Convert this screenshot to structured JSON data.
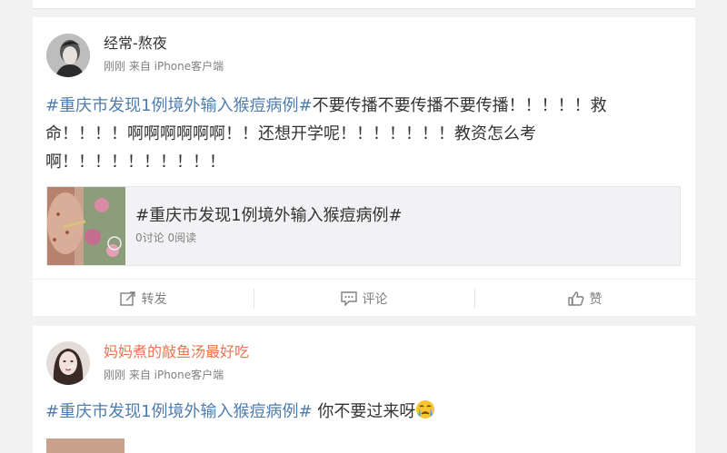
{
  "posts": [
    {
      "username": "经常-熬夜",
      "meta": "刚刚 来自 iPhone客户端",
      "topic": "#重庆市发现1例境外输入猴痘病例#",
      "text": "不要传播不要传播不要传播！！！！！救命！！！！啊啊啊啊啊啊！！还想开学呢！！！！！！！教资怎么考啊！！！！！！！！！！",
      "topic_card": {
        "title": "#重庆市发现1例境外输入猴痘病例#",
        "stats": "0讨论 0阅读"
      },
      "actions": {
        "repost": "转发",
        "comment": "评论",
        "like": "赞"
      }
    },
    {
      "username": "妈妈煮的敲鱼汤最好吃",
      "meta": "刚刚 来自 iPhone客户端",
      "topic": "#重庆市发现1例境外输入猴痘病例#",
      "text": " 你不要过来呀",
      "emoji": "crying-face-icon"
    }
  ],
  "colors": {
    "topic_link": "#507daf",
    "username_highlight": "#eb7350",
    "meta_gray": "#808080",
    "background": "#f2f2f2"
  }
}
